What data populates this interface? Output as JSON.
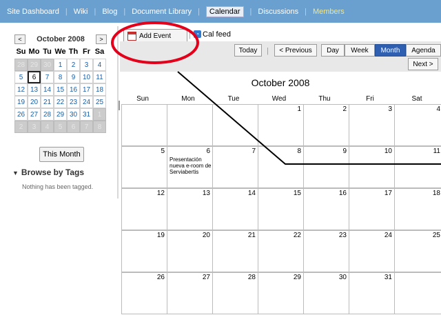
{
  "nav": {
    "items": [
      {
        "label": "Site Dashboard"
      },
      {
        "label": "Wiki"
      },
      {
        "label": "Blog"
      },
      {
        "label": "Document Library"
      },
      {
        "label": "Calendar"
      },
      {
        "label": "Discussions"
      },
      {
        "label": "Members"
      }
    ],
    "active": "Calendar",
    "colors": {
      "bar": "#6aa0d0",
      "members": "#f0e68c"
    }
  },
  "minical": {
    "title": "October 2008",
    "prev": "<",
    "next": ">",
    "dow": [
      "Su",
      "Mo",
      "Tu",
      "We",
      "Th",
      "Fr",
      "Sa"
    ],
    "weeks": [
      [
        "28",
        "29",
        "30",
        "1",
        "2",
        "3",
        "4"
      ],
      [
        "5",
        "6",
        "7",
        "8",
        "9",
        "10",
        "11"
      ],
      [
        "12",
        "13",
        "14",
        "15",
        "16",
        "17",
        "18"
      ],
      [
        "19",
        "20",
        "21",
        "22",
        "23",
        "24",
        "25"
      ],
      [
        "26",
        "27",
        "28",
        "29",
        "30",
        "31",
        "1"
      ],
      [
        "2",
        "3",
        "4",
        "5",
        "6",
        "7",
        "8"
      ]
    ],
    "today": "6",
    "this_month": "This Month"
  },
  "tags": {
    "heading": "Browse by Tags",
    "empty": "Nothing has been tagged."
  },
  "toolbar": {
    "add_event": "Add Event",
    "cal_feed": "Cal feed",
    "today": "Today",
    "previous": "< Previous",
    "next": "Next >",
    "views": [
      "Day",
      "Week",
      "Month",
      "Agenda"
    ],
    "selected_view": "Month"
  },
  "calendar": {
    "title": "October 2008",
    "dow": [
      "Sun",
      "Mon",
      "Tue",
      "Wed",
      "Thu",
      "Fri",
      "Sat"
    ],
    "weeks": [
      [
        "",
        "",
        "",
        "1",
        "2",
        "3",
        "4"
      ],
      [
        "5",
        "6",
        "7",
        "8",
        "9",
        "10",
        "11"
      ],
      [
        "12",
        "13",
        "14",
        "15",
        "16",
        "17",
        "18"
      ],
      [
        "19",
        "20",
        "21",
        "22",
        "23",
        "24",
        "25"
      ],
      [
        "26",
        "27",
        "28",
        "29",
        "30",
        "31",
        ""
      ]
    ],
    "events": [
      {
        "day": "6",
        "text": "Presentación nueva e-room de Serviabertis"
      }
    ]
  }
}
